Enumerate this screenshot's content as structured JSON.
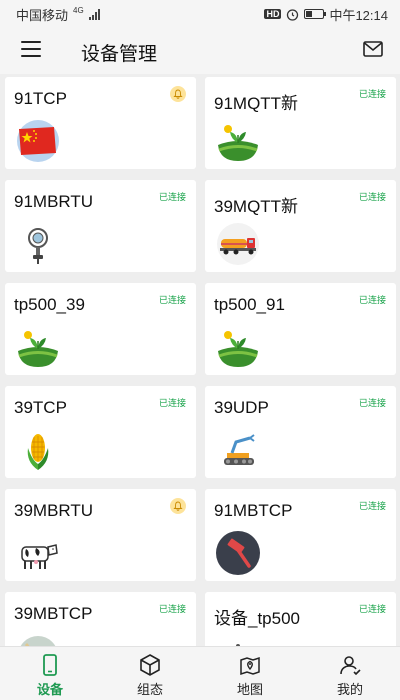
{
  "status_bar": {
    "carrier": "中国移动",
    "network": "4G",
    "hd": "HD",
    "time": "中午12:14"
  },
  "header": {
    "title": "设备管理"
  },
  "devices": [
    {
      "name": "91TCP",
      "status": "",
      "alert": true,
      "icon": "china-flag-icon"
    },
    {
      "name": "91MQTT新",
      "status": "已连接",
      "alert": false,
      "icon": "plant-field-icon"
    },
    {
      "name": "91MBRTU",
      "status": "已连接",
      "alert": false,
      "icon": "sensor-probe-icon"
    },
    {
      "name": "39MQTT新",
      "status": "已连接",
      "alert": false,
      "icon": "tanker-truck-icon"
    },
    {
      "name": "tp500_39",
      "status": "已连接",
      "alert": false,
      "icon": "plant-field-icon"
    },
    {
      "name": "tp500_91",
      "status": "已连接",
      "alert": false,
      "icon": "plant-field-icon"
    },
    {
      "name": "39TCP",
      "status": "已连接",
      "alert": false,
      "icon": "corn-icon"
    },
    {
      "name": "39UDP",
      "status": "已连接",
      "alert": false,
      "icon": "robot-arm-icon"
    },
    {
      "name": "39MBRTU",
      "status": "",
      "alert": true,
      "icon": "cow-icon"
    },
    {
      "name": "91MBTCP",
      "status": "已连接",
      "alert": false,
      "icon": "hammer-icon"
    },
    {
      "name": "39MBTCP",
      "status": "已连接",
      "alert": false,
      "icon": "globe-icon"
    },
    {
      "name": "设备_tp500",
      "status": "已连接",
      "alert": false,
      "icon": "antenna-icon"
    }
  ],
  "tabs": [
    {
      "label": "设备",
      "icon": "phone-icon",
      "active": true
    },
    {
      "label": "组态",
      "icon": "cube-icon",
      "active": false
    },
    {
      "label": "地图",
      "icon": "map-pin-icon",
      "active": false
    },
    {
      "label": "我的",
      "icon": "user-icon",
      "active": false
    }
  ],
  "colors": {
    "accent": "#1f9a52",
    "connected": "#19a34a",
    "alert_bg": "#fde39a"
  }
}
